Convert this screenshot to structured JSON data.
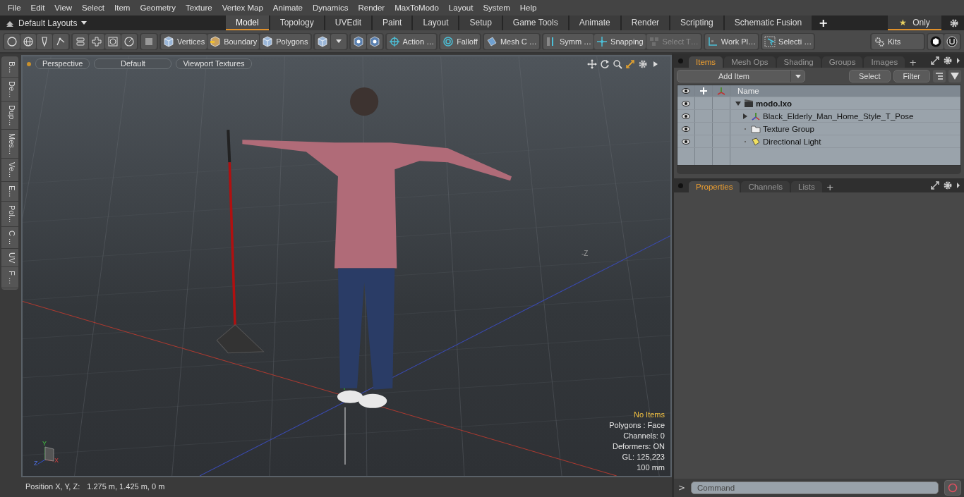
{
  "menu": [
    "File",
    "Edit",
    "View",
    "Select",
    "Item",
    "Geometry",
    "Texture",
    "Vertex Map",
    "Animate",
    "Dynamics",
    "Render",
    "MaxToModo",
    "Layout",
    "System",
    "Help"
  ],
  "layout_selector": "Default Layouts",
  "layout_tabs": [
    {
      "label": "Model",
      "selected": true
    },
    {
      "label": "Topology",
      "selected": false
    },
    {
      "label": "UVEdit",
      "selected": false
    },
    {
      "label": "Paint",
      "selected": false
    },
    {
      "label": "Layout",
      "selected": false
    },
    {
      "label": "Setup",
      "selected": false
    },
    {
      "label": "Game Tools",
      "selected": false
    },
    {
      "label": "Animate",
      "selected": false
    },
    {
      "label": "Render",
      "selected": false
    },
    {
      "label": "Scripting",
      "selected": false
    },
    {
      "label": "Schematic Fusion",
      "selected": false
    }
  ],
  "add_tab": "+",
  "only_toggle": {
    "icon": "★",
    "label": "Only"
  },
  "toolbar": [
    {
      "label": "Vertices",
      "disabled": false
    },
    {
      "label": "Boundary",
      "disabled": false
    },
    {
      "label": "Polygons",
      "disabled": false
    },
    {
      "label": "Action  …",
      "disabled": false
    },
    {
      "label": "Falloff",
      "disabled": false
    },
    {
      "label": "Mesh C …",
      "disabled": false
    },
    {
      "label": "Symm …",
      "disabled": false
    },
    {
      "label": "Snapping",
      "disabled": false
    },
    {
      "label": "Select T…",
      "disabled": true
    },
    {
      "label": "Work Pl…",
      "disabled": false
    },
    {
      "label": "Selecti …",
      "disabled": false
    },
    {
      "label": "Kits",
      "disabled": false
    }
  ],
  "side_tabs": [
    "B...",
    "De...",
    "Dup...",
    "Mes...",
    "Ve...",
    "E...",
    "Pol...",
    "C ...",
    "UV",
    "F ..."
  ],
  "viewport": {
    "buttons": [
      "Perspective",
      "Default",
      "Viewport Textures"
    ],
    "axis_label": "-Z",
    "gizmo": {
      "y": "Y",
      "z": "Z",
      "x": "X"
    },
    "info": [
      {
        "text": "No Items",
        "highlight": true
      },
      {
        "text": "Polygons : Face",
        "highlight": false
      },
      {
        "text": "Channels: 0",
        "highlight": false
      },
      {
        "text": "Deformers: ON",
        "highlight": false
      },
      {
        "text": "GL: 125,223",
        "highlight": false
      },
      {
        "text": "100 mm",
        "highlight": false
      }
    ]
  },
  "items_panel": {
    "tabs": [
      {
        "label": "Items",
        "selected": true
      },
      {
        "label": "Mesh Ops",
        "selected": false
      },
      {
        "label": "Shading",
        "selected": false
      },
      {
        "label": "Groups",
        "selected": false
      },
      {
        "label": "Images",
        "selected": false
      }
    ],
    "add_tab": "+",
    "add_item": "Add Item",
    "buttons": [
      "Select",
      "Filter"
    ],
    "column": "Name",
    "items": [
      {
        "label": "modo.lxo",
        "kind": "scene",
        "visible": true,
        "expanded": true,
        "children": [
          {
            "label": "Black_Elderly_Man_Home_Style_T_Pose",
            "kind": "mesh",
            "visible": true,
            "expanded": false
          },
          {
            "label": "Texture Group",
            "kind": "group",
            "visible": true
          },
          {
            "label": "Directional Light",
            "kind": "light",
            "visible": true
          }
        ]
      }
    ]
  },
  "properties_panel": {
    "tabs": [
      {
        "label": "Properties",
        "selected": true
      },
      {
        "label": "Channels",
        "selected": false
      },
      {
        "label": "Lists",
        "selected": false
      }
    ],
    "add_tab": "+"
  },
  "command": {
    "prompt": ">",
    "placeholder": "Command"
  },
  "status_bar": {
    "label": "Position X, Y, Z:",
    "value": "1.275 m, 1.425 m, 0 m"
  }
}
